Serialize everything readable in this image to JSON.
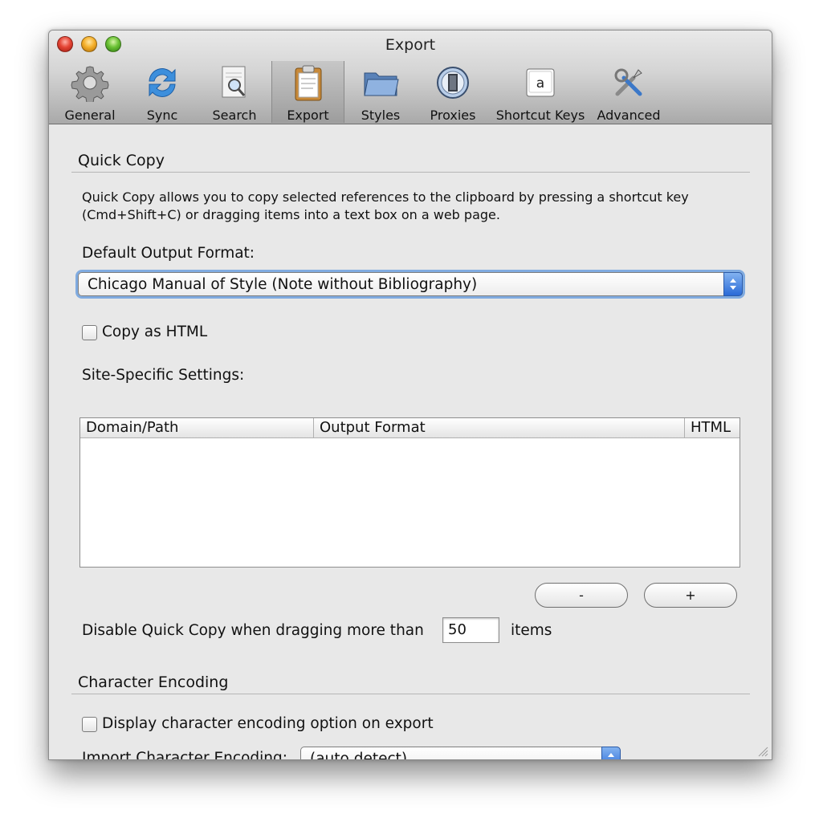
{
  "window": {
    "title": "Export"
  },
  "toolbar": {
    "items": [
      {
        "label": "General",
        "icon": "gear-icon"
      },
      {
        "label": "Sync",
        "icon": "sync-icon"
      },
      {
        "label": "Search",
        "icon": "search-icon"
      },
      {
        "label": "Export",
        "icon": "clipboard-icon",
        "selected": true
      },
      {
        "label": "Styles",
        "icon": "folder-icon"
      },
      {
        "label": "Proxies",
        "icon": "proxies-icon"
      },
      {
        "label": "Shortcut Keys",
        "icon": "key-icon",
        "key_glyph": "a"
      },
      {
        "label": "Advanced",
        "icon": "tools-icon"
      }
    ]
  },
  "quick_copy": {
    "title": "Quick Copy",
    "description": "Quick Copy allows you to copy selected references to the clipboard by pressing a shortcut key (Cmd+Shift+C) or dragging items into a text box on a web page.",
    "default_format_label": "Default Output Format:",
    "default_format_value": "Chicago Manual of Style (Note without Bibliography)",
    "copy_as_html_label": "Copy as HTML",
    "copy_as_html_checked": false,
    "site_settings_label": "Site-Specific Settings:",
    "table_columns": [
      "Domain/Path",
      "Output Format",
      "HTML"
    ],
    "table_rows": [],
    "remove_button": "-",
    "add_button": "+",
    "disable_prefix": "Disable Quick Copy when dragging more than",
    "disable_value": "50",
    "disable_suffix": "items"
  },
  "character_encoding": {
    "title": "Character Encoding",
    "display_option_label": "Display character encoding option on export",
    "display_option_checked": false,
    "import_label": "Import Character Encoding:",
    "import_value": "(auto detect)"
  },
  "colors": {
    "accent": "#3a78dc",
    "window_bg": "#e8e8e8",
    "focus_ring": "#5e97de"
  }
}
